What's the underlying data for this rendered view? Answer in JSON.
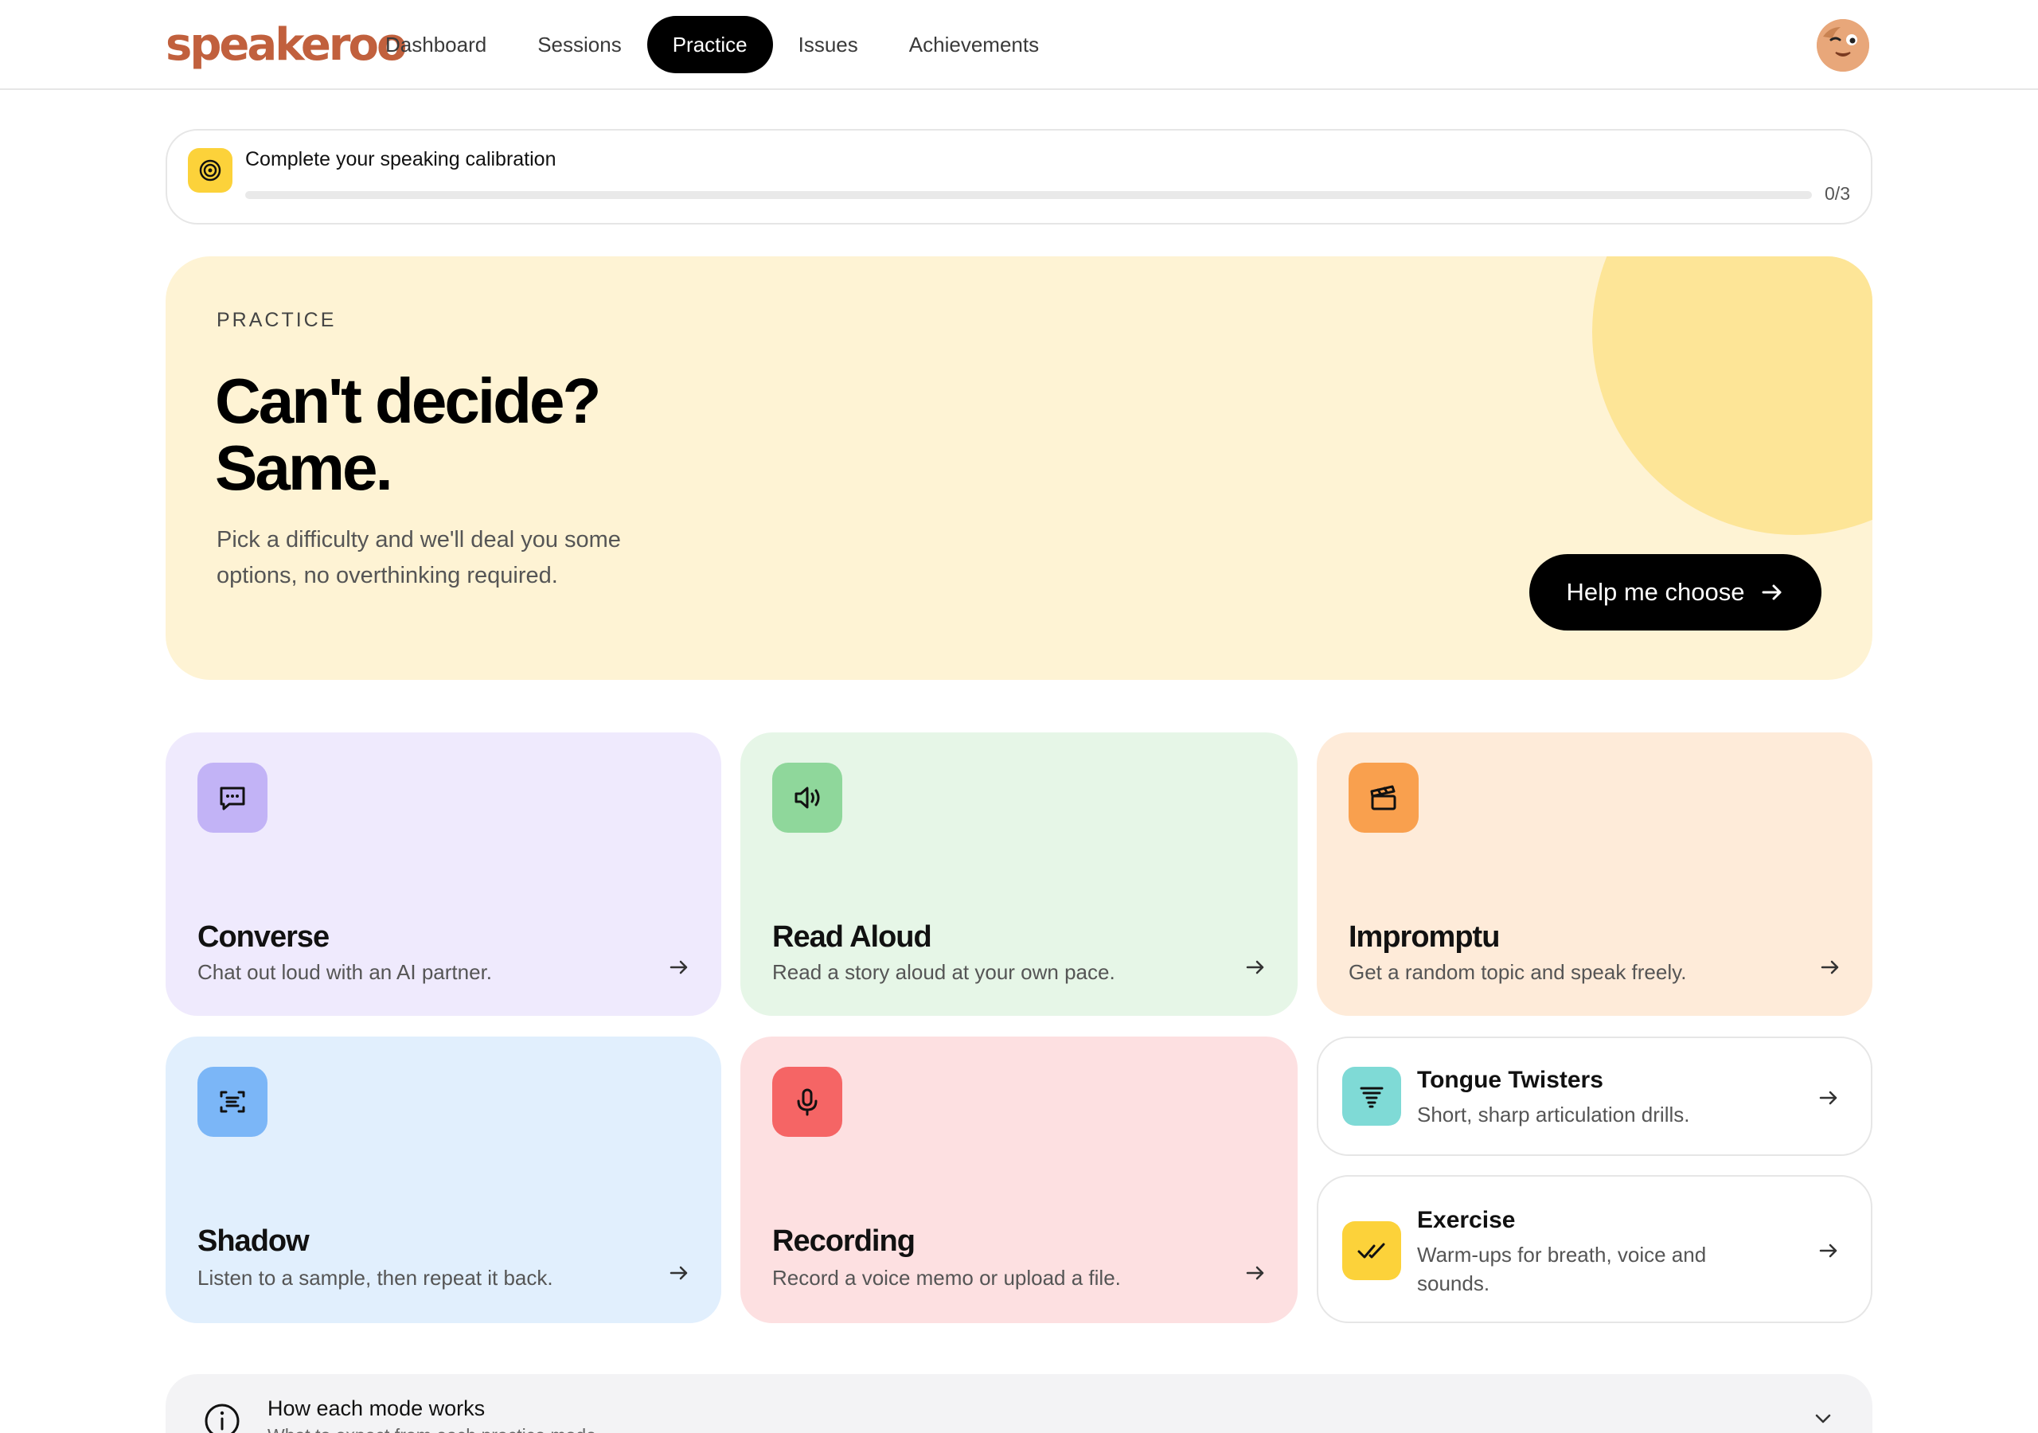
{
  "brand": {
    "logo_text": "speakeroo",
    "accent": "#c1603d"
  },
  "nav": {
    "items": [
      {
        "label": "Dashboard",
        "active": false
      },
      {
        "label": "Sessions",
        "active": false
      },
      {
        "label": "Practice",
        "active": true
      },
      {
        "label": "Issues",
        "active": false
      },
      {
        "label": "Achievements",
        "active": false
      }
    ],
    "avatar_icon": "user-avatar-face-icon"
  },
  "calibration": {
    "title": "Complete your speaking calibration",
    "count": "0/3",
    "progress": 0,
    "icon": "target-icon"
  },
  "hero": {
    "eyebrow": "PRACTICE",
    "title": "Can't decide? Same.",
    "subtitle": "Pick a difficulty and we'll deal you some options, no overthinking required.",
    "button_label": "Help me choose",
    "bg": "#fef3d4"
  },
  "modes": [
    {
      "title": "Converse",
      "desc": "Chat out loud with an AI partner.",
      "icon": "chat-bubble-icon",
      "bg": "#efeafd",
      "icon_bg": "#c2b3f6"
    },
    {
      "title": "Read Aloud",
      "desc": "Read a story aloud at your own pace.",
      "icon": "speaker-icon",
      "bg": "#e6f6e7",
      "icon_bg": "#8fd79b"
    },
    {
      "title": "Impromptu",
      "desc": "Get a random topic and speak freely.",
      "icon": "clapperboard-icon",
      "bg": "#feebd9",
      "icon_bg": "#f9a04e"
    },
    {
      "title": "Shadow",
      "desc": "Listen to a sample, then repeat it back.",
      "icon": "scan-text-icon",
      "bg": "#e1effd",
      "icon_bg": "#7bb6f7"
    },
    {
      "title": "Recording",
      "desc": "Record a voice memo or upload a file.",
      "icon": "microphone-icon",
      "bg": "#fde0e1",
      "icon_bg": "#f56565"
    }
  ],
  "extras": [
    {
      "title": "Tongue Twisters",
      "desc": "Short, sharp articulation drills.",
      "icon": "tornado-icon",
      "icon_bg": "#7fdad6"
    },
    {
      "title": "Exercise",
      "desc": "Warm-ups for breath, voice and sounds.",
      "icon": "double-check-icon",
      "icon_bg": "#fcd23a"
    }
  ],
  "how": {
    "title": "How each mode works",
    "subtitle": "What to expect from each practice mode",
    "icon": "info-icon"
  }
}
